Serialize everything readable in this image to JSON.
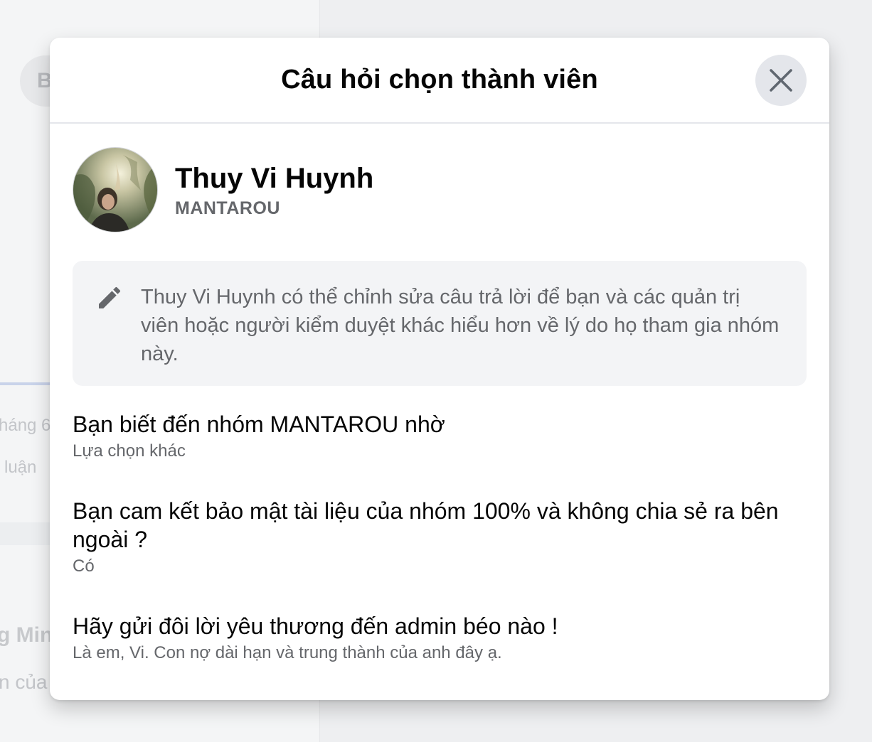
{
  "background": {
    "chip_label": "B",
    "text_1": "háng 6",
    "text_2": "luận",
    "text_3": "g Min",
    "text_4": "n của"
  },
  "modal": {
    "title": "Câu hỏi chọn thành viên",
    "close_icon": "close-icon"
  },
  "profile": {
    "name": "Thuy Vi Huynh",
    "group": "MANTAROU"
  },
  "notice": {
    "icon": "pencil-icon",
    "text": "Thuy Vi Huynh có thể chỉnh sửa câu trả lời để bạn và các quản trị viên hoặc người kiểm duyệt khác hiểu hơn về lý do họ tham gia nhóm này."
  },
  "questions": [
    {
      "question": "Bạn biết đến nhóm MANTAROU nhờ",
      "answer": "Lựa chọn khác"
    },
    {
      "question": "Bạn cam kết bảo mật tài liệu của nhóm 100% và không chia sẻ ra bên ngoài ?",
      "answer": "Có"
    },
    {
      "question": "Hãy gửi đôi lời yêu thương đến admin béo nào !",
      "answer": "Là em, Vi. Con nợ dài hạn và trung thành của anh đây ạ."
    }
  ]
}
